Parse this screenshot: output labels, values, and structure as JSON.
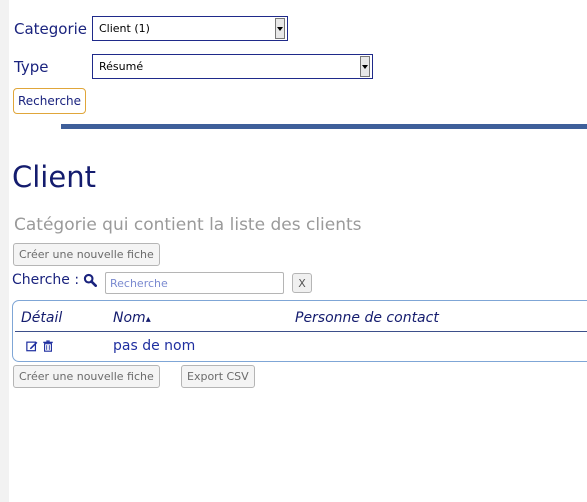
{
  "filters": {
    "categorie_label": "Categorie",
    "categorie_value": "Client (1)",
    "type_label": "Type",
    "type_value": "Résumé",
    "search_button": "Recherche"
  },
  "page": {
    "title": "Client",
    "subtitle": "Catégorie qui contient la liste des clients",
    "create_button_top": "Créer une nouvelle fiche"
  },
  "search": {
    "label": "Cherche :",
    "placeholder": "Recherche",
    "clear_label": "X"
  },
  "table": {
    "headers": [
      "Détail",
      "Nom",
      "Personne de contact"
    ],
    "sort_indicator": "▴",
    "rows": [
      {
        "nom": "pas de nom",
        "personne_de_contact": "",
        "icons": [
          "edit-icon",
          "trash-icon"
        ]
      }
    ]
  },
  "footer": {
    "create_button": "Créer une nouvelle fiche",
    "export_button": "Export CSV"
  },
  "colors": {
    "accent": "#1a237e",
    "divider": "#3e5f9a",
    "search_button_border": "#e0a63a",
    "table_border": "#7fa6d6"
  }
}
